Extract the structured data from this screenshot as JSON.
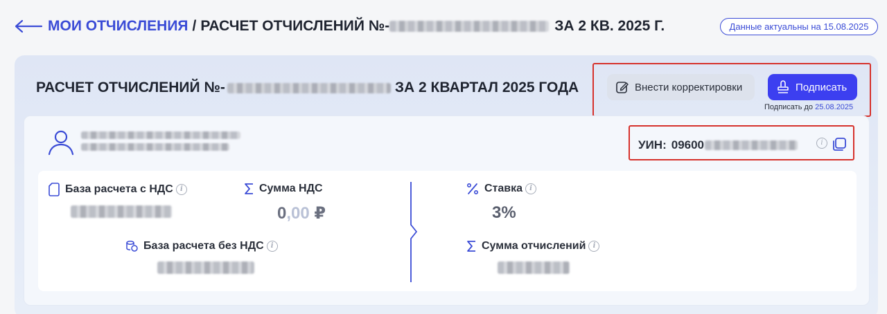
{
  "header": {
    "breadcrumb_link": "МОИ ОТЧИСЛЕНИЯ",
    "separator": "/",
    "title_prefix": "РАСЧЕТ ОТЧИСЛЕНИЙ №-",
    "title_suffix": "ЗА 2 КВ. 2025 Г.",
    "actual_badge": "Данные актуальны на 15.08.2025"
  },
  "card": {
    "title_prefix": "РАСЧЕТ ОТЧИСЛЕНИЙ №-",
    "title_suffix": "ЗА 2 КВАРТАЛ 2025 ГОДА",
    "correct_button": "Внести корректировки",
    "sign_button": "Подписать",
    "sign_deadline_label": "Подписать до",
    "sign_deadline_date": "25.08.2025",
    "uin_label": "УИН:",
    "uin_visible": "09600"
  },
  "metrics": {
    "base_with_vat_label": "База расчета с НДС",
    "vat_sum_label": "Сумма НДС",
    "vat_sum_whole": "0",
    "vat_sum_cents": ",00",
    "vat_sum_currency": "₽",
    "base_without_vat_label": "База расчета без НДС",
    "rate_label": "Ставка",
    "rate_value": "3%",
    "deduction_sum_label": "Сумма отчислений"
  },
  "colors": {
    "accent": "#3a4bd6",
    "primary_button": "#3c3ff0",
    "highlight_border": "#d6312b"
  }
}
